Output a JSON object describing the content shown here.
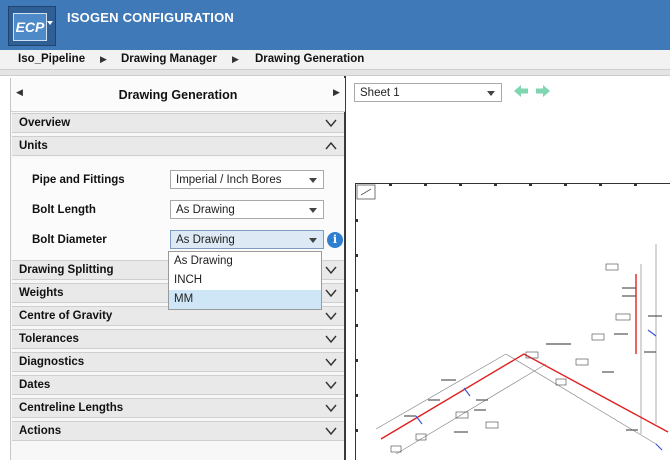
{
  "app": {
    "logo_text": "ECP",
    "title": "ISOGEN CONFIGURATION"
  },
  "breadcrumb": {
    "items": [
      "Iso_Pipeline",
      "Drawing Manager",
      "Drawing Generation"
    ]
  },
  "panel": {
    "title": "Drawing Generation",
    "sections": {
      "overview": "Overview",
      "units": "Units",
      "drawing_splitting": "Drawing Splitting",
      "weights": "Weights",
      "centre_of_gravity": "Centre of Gravity",
      "tolerances": "Tolerances",
      "diagnostics": "Diagnostics",
      "dates": "Dates",
      "centreline_lengths": "Centreline Lengths",
      "actions": "Actions"
    },
    "units": {
      "pipe_and_fittings": {
        "label": "Pipe and Fittings",
        "value": "Imperial / Inch Bores"
      },
      "bolt_length": {
        "label": "Bolt Length",
        "value": "As Drawing"
      },
      "bolt_diameter": {
        "label": "Bolt Diameter",
        "value": "As Drawing"
      }
    },
    "bolt_diameter_options": [
      "As Drawing",
      "INCH",
      "MM"
    ]
  },
  "viewer": {
    "sheet_select": "Sheet 1"
  },
  "colors": {
    "titlebar": "#3f79b7",
    "accent": "#2f7fd1",
    "nav_arrow": "#7fd6b0",
    "pipe_red": "#e02020"
  }
}
